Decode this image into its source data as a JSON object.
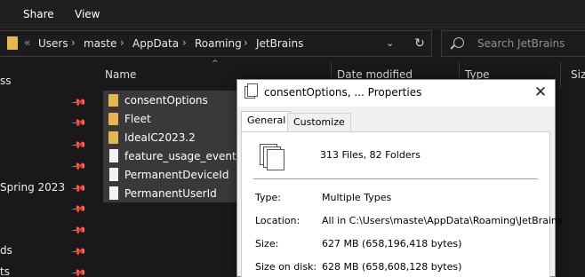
{
  "ribbon": {
    "tabs": [
      "Share",
      "View"
    ]
  },
  "address": {
    "crumbs": [
      "Users",
      "maste",
      "AppData",
      "Roaming",
      "JetBrains"
    ],
    "prefix": "«",
    "separator": "›",
    "dropdown": "⌄",
    "refresh": "↻"
  },
  "search": {
    "placeholder": "Search JetBrains"
  },
  "nav": {
    "items": [
      "ss",
      "",
      "",
      "",
      "Spring 2023",
      "",
      "",
      "ds",
      "ts"
    ],
    "pin": "📌"
  },
  "list": {
    "columns": [
      "Name",
      "Date modified",
      "Type",
      "Siz"
    ],
    "sort_arrow": "^",
    "rows": [
      {
        "name": "consentOptions",
        "kind": "folder"
      },
      {
        "name": "Fleet",
        "kind": "folder"
      },
      {
        "name": "IdeaIC2023.2",
        "kind": "folder"
      },
      {
        "name": "feature_usage_event_log",
        "kind": "file"
      },
      {
        "name": "PermanentDeviceId",
        "kind": "file"
      },
      {
        "name": "PermanentUserId",
        "kind": "file"
      }
    ]
  },
  "dialog": {
    "title": "consentOptions, ... Properties",
    "close": "✕",
    "tabs": [
      "General",
      "Customize"
    ],
    "active_tab": "General",
    "count": "313 Files, 82 Folders",
    "properties": [
      {
        "label": "Type:",
        "value": "Multiple Types"
      },
      {
        "label": "Location:",
        "value": "All in C:\\Users\\maste\\AppData\\Roaming\\JetBrains"
      },
      {
        "label": "Size:",
        "value": "627 MB (658,196,418 bytes)"
      },
      {
        "label": "Size on disk:",
        "value": "628 MB (658,608,128 bytes)"
      }
    ]
  },
  "colors": {
    "folder": "#e6b64f",
    "selection": "#393939",
    "background": "#191919"
  }
}
